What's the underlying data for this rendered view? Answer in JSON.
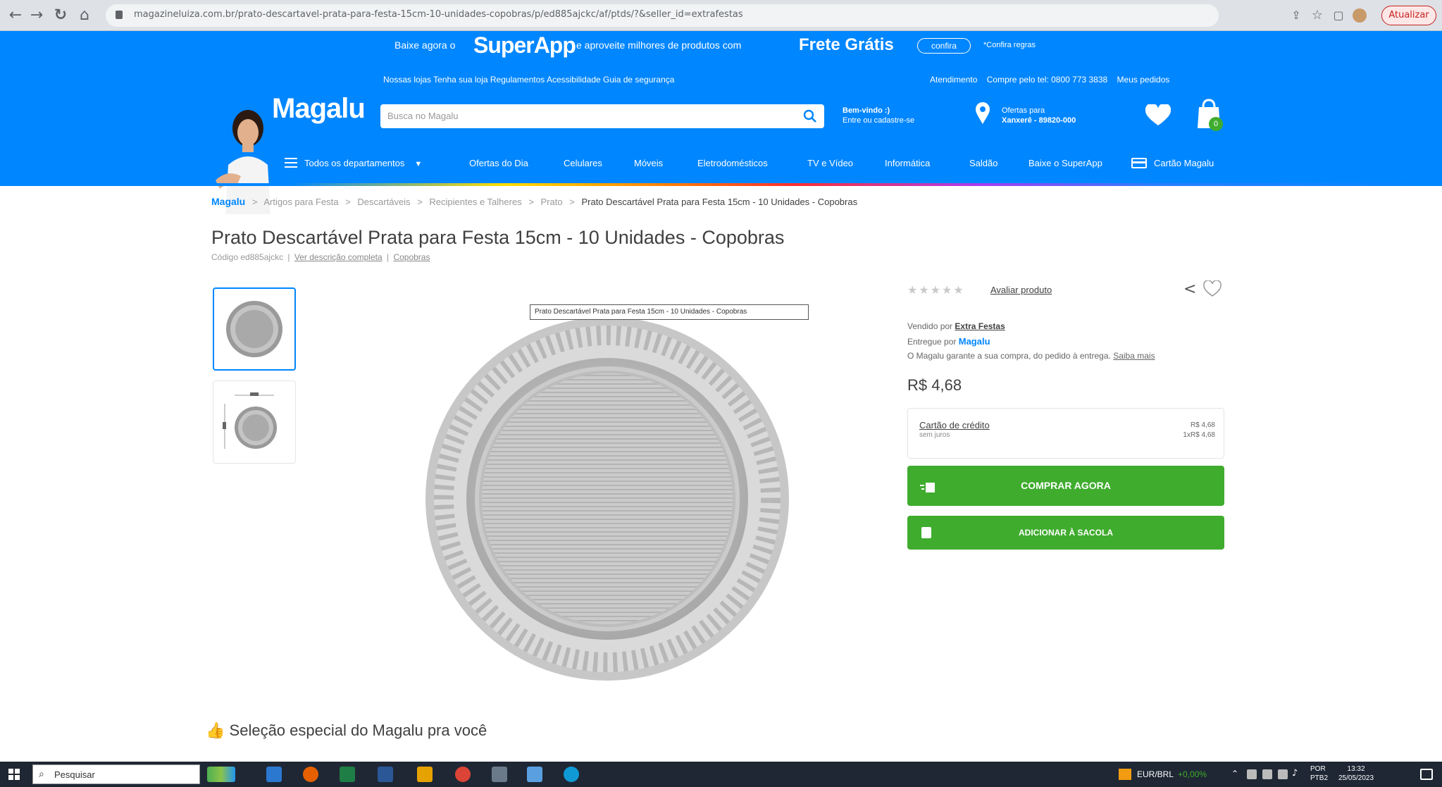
{
  "browser": {
    "url": "magazineluiza.com.br/prato-descartavel-prata-para-festa-15cm-10-unidades-copobras/p/ed885ajckc/af/ptds/?&seller_id=extrafestas",
    "update_label": "Atualizar"
  },
  "promo": {
    "pre": "Baixe agora o",
    "app": "SuperApp",
    "mid": "e aproveite milhores de produtos com",
    "frete": "Frete Grátis",
    "confira": "confira",
    "regras": "*Confira regras"
  },
  "toplinks": [
    "Nossas lojas",
    "Tenha sua loja",
    "Regulamentos",
    "Acessibilidade",
    "Guia de segurança"
  ],
  "toplinks_right": [
    "Atendimento",
    "Compre pelo tel: 0800 773 3838",
    "Meus pedidos"
  ],
  "header": {
    "logo": "Magalu",
    "search_placeholder": "Busca no Magalu",
    "welcome_line1": "Bem-vindo :)",
    "welcome_line2": "Entre ou cadastre-se",
    "offers_line1": "Ofertas para",
    "offers_line2": "Xanxerê - 89820-000",
    "cart_count": "0"
  },
  "nav": {
    "departments": "Todos os departamentos",
    "items": [
      "Ofertas do Dia",
      "Celulares",
      "Móveis",
      "Eletrodomésticos",
      "TV e Vídeo",
      "Informática",
      "Saldão",
      "Baixe o SuperApp"
    ],
    "card": "Cartão Magalu"
  },
  "breadcrumb": {
    "home": "Magalu",
    "items": [
      "Artigos para Festa",
      "Descartáveis",
      "Recipientes e Talheres",
      "Prato"
    ],
    "current": "Prato Descartável Prata para Festa 15cm - 10 Unidades - Copobras",
    "sep": ">"
  },
  "product": {
    "title": "Prato Descartável Prata para Festa 15cm - 10 Unidades - Copobras",
    "code": "Código ed885ajckc",
    "code_sep": "|",
    "desc_link": "Ver descrição completa",
    "brand_link": "Copobras",
    "tooltip": "Prato Descartável Prata para Festa 15cm - 10 Unidades - Copobras"
  },
  "buybox": {
    "stars": "★★★★★",
    "rate_link": "Avaliar produto",
    "sold_by_label": "Vendido por",
    "sold_by": "Extra Festas",
    "delivered_by_label": "Entregue por",
    "delivered_by": "Magalu",
    "guarantee": "O Magalu garante a sua compra, do pedido à entrega.",
    "guarantee_link": "Saiba mais",
    "price": "R$ 4,68",
    "card_label": "Cartão de crédito",
    "card_sub": "sem juros",
    "card_price": "R$ 4,68",
    "card_installment": "1xR$ 4,68",
    "buy_now": "COMPRAR AGORA",
    "add_bag": "ADICIONAR À SACOLA"
  },
  "section": {
    "selection": "Seleção especial do Magalu pra você"
  },
  "taskbar": {
    "search": "Pesquisar",
    "currency": "EUR/BRL",
    "currency_change": "+0,00%",
    "lang1": "POR",
    "lang2": "PTB2",
    "time": "13:32",
    "date": "25/05/2023"
  },
  "colors": {
    "brand_blue": "#0086ff",
    "buy_green": "#3fac2e"
  }
}
